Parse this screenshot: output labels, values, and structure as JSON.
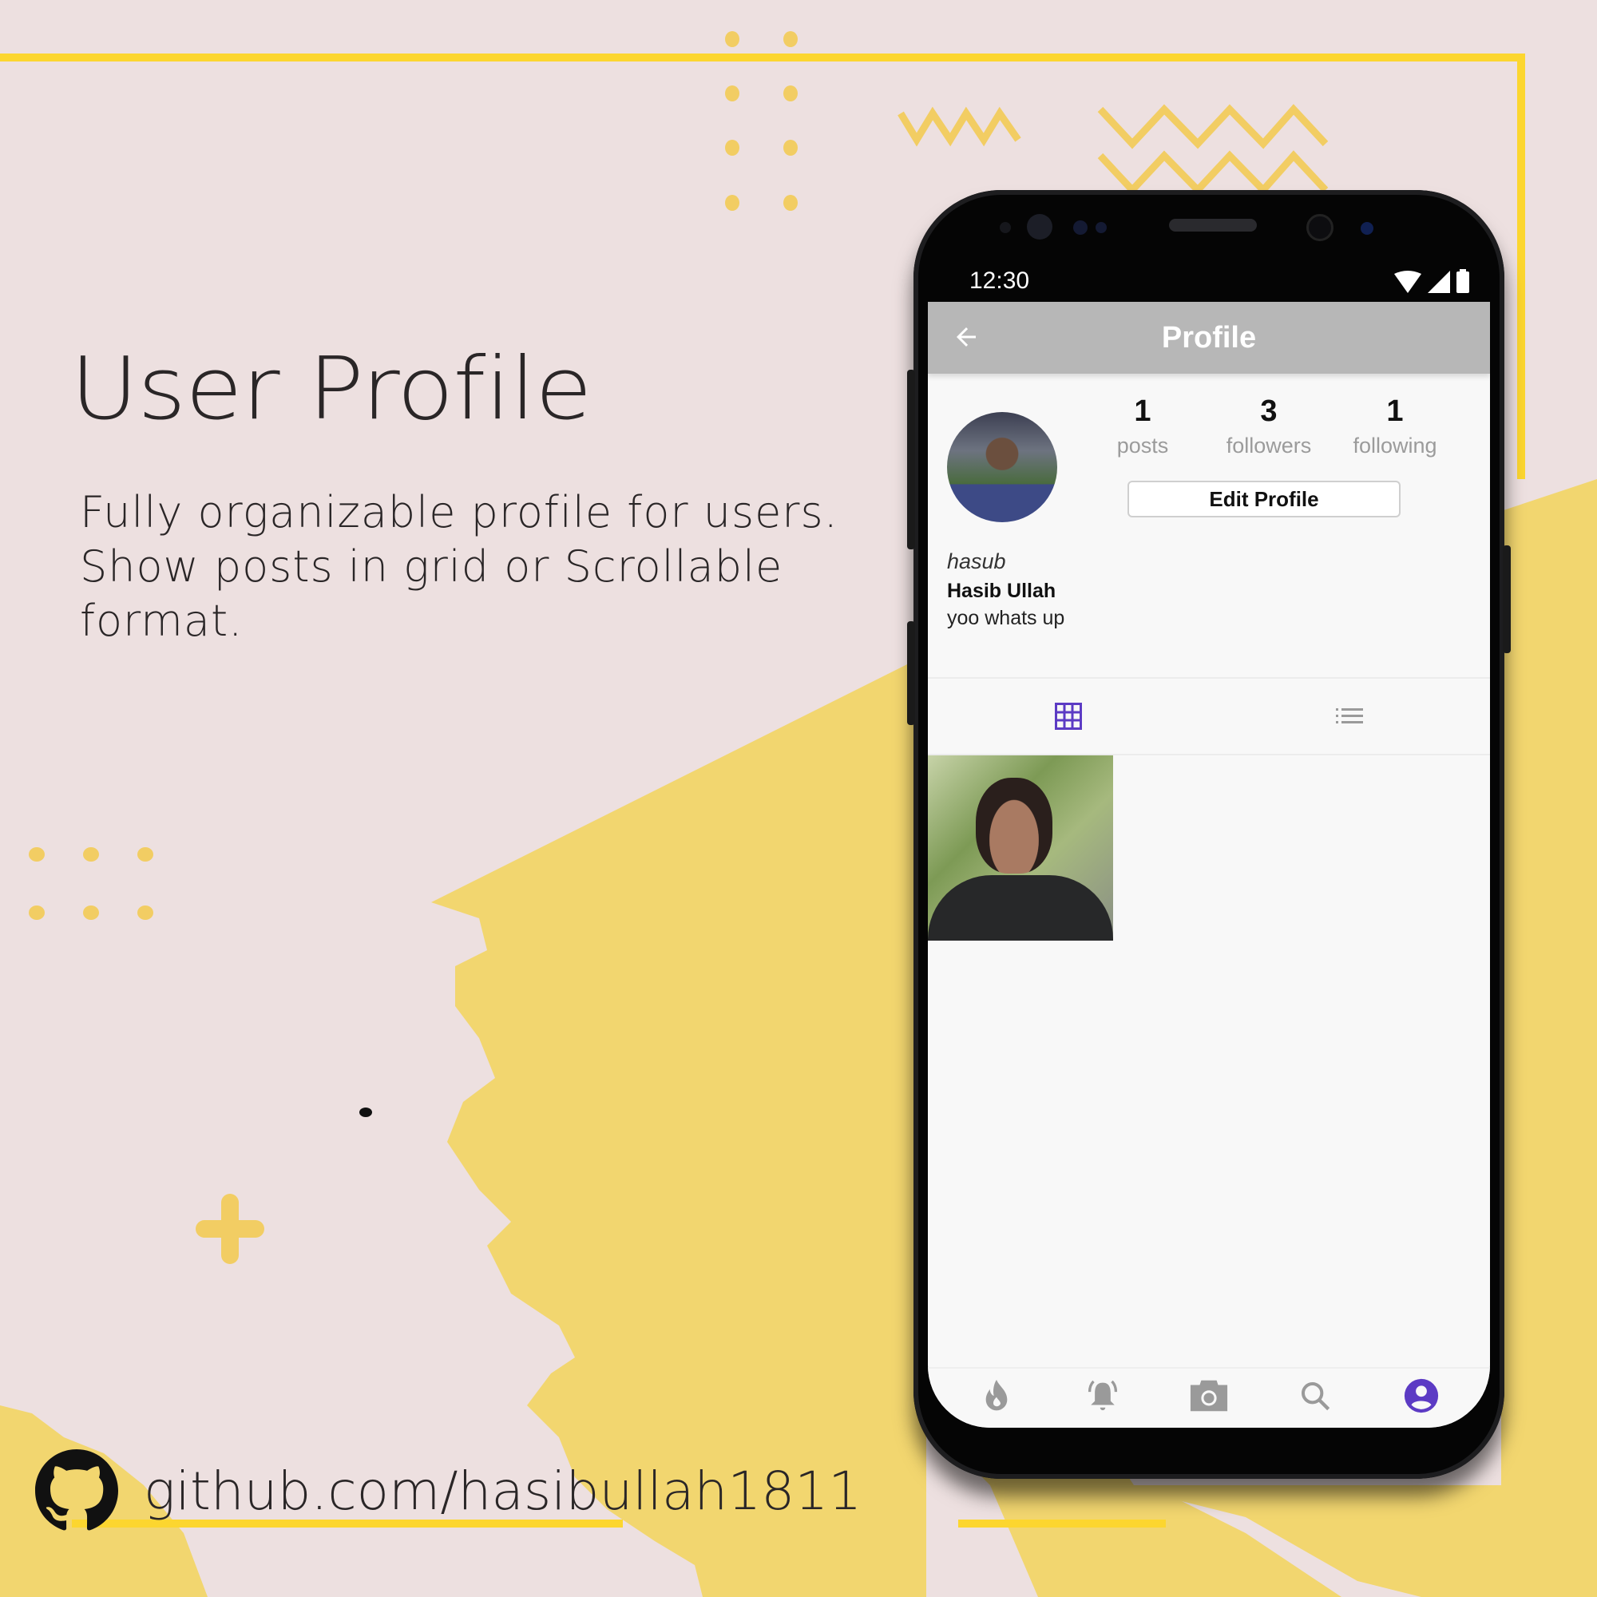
{
  "hero": {
    "title": "User Profile",
    "description": "Fully organizable profile for users. Show posts in grid or Scrollable format."
  },
  "footer": {
    "github_icon": "github-icon",
    "link_text": "github.com/hasibullah1811"
  },
  "colors": {
    "background": "#ede0e0",
    "accent_yellow": "#f2d66f",
    "frame_yellow": "#fcd62f",
    "app_accent": "#5c3bc4",
    "app_bar": "#b7b7b7",
    "icon_gray": "#9a9a9a"
  },
  "phone": {
    "status_bar": {
      "time": "12:30",
      "icons": [
        "wifi-icon",
        "signal-icon",
        "battery-icon"
      ]
    },
    "app_bar": {
      "back_icon": "arrow-left-icon",
      "title": "Profile"
    },
    "profile": {
      "stats": [
        {
          "value": "1",
          "label": "posts"
        },
        {
          "value": "3",
          "label": "followers"
        },
        {
          "value": "1",
          "label": "following"
        }
      ],
      "edit_button": "Edit Profile",
      "username": "hasub",
      "display_name": "Hasib Ullah",
      "bio": "yoo whats up"
    },
    "view_toggle": [
      {
        "icon": "grid-icon",
        "active": true
      },
      {
        "icon": "list-icon",
        "active": false
      }
    ],
    "posts": [
      {
        "type": "photo"
      }
    ],
    "bottom_nav": [
      {
        "icon": "flame-icon",
        "active": false
      },
      {
        "icon": "bell-icon",
        "active": false
      },
      {
        "icon": "camera-icon",
        "active": false
      },
      {
        "icon": "search-icon",
        "active": false
      },
      {
        "icon": "account-circle-icon",
        "active": true
      }
    ]
  }
}
